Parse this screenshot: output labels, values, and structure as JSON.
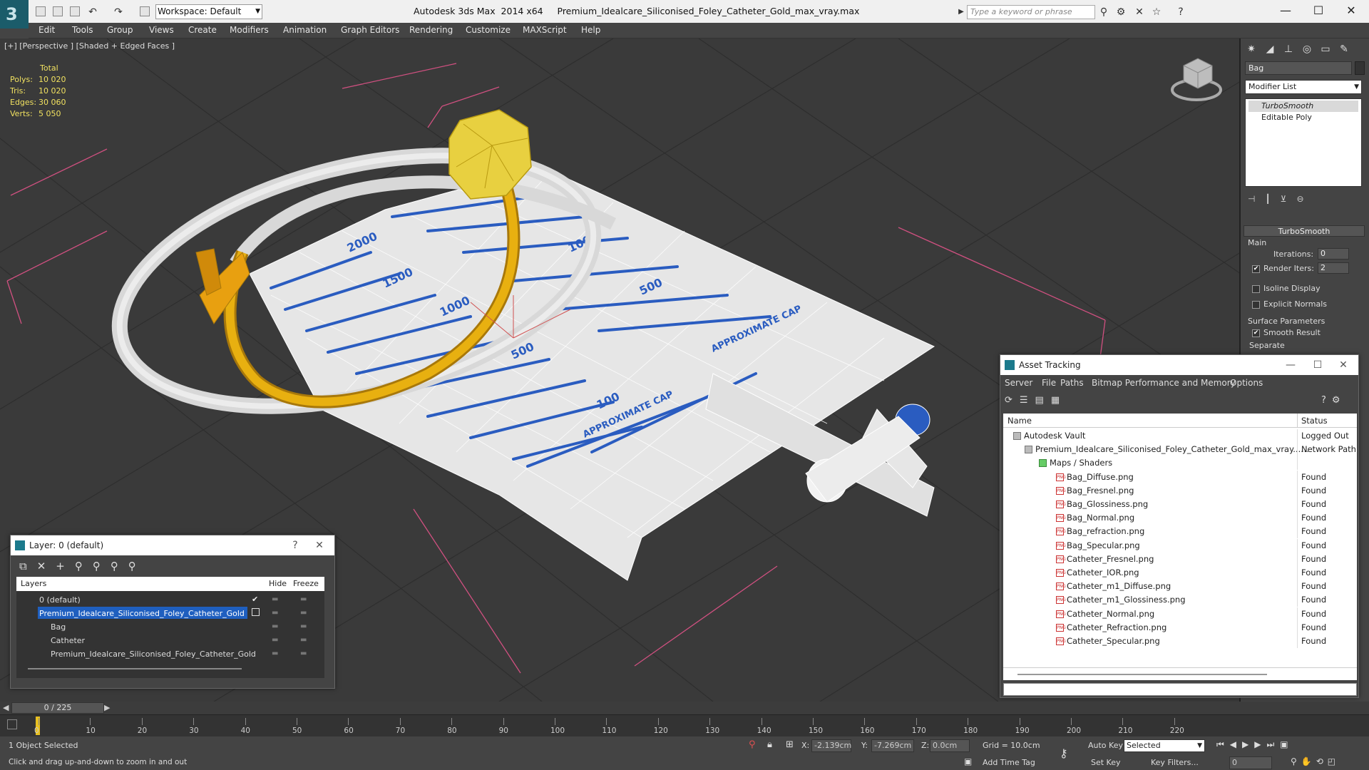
{
  "titlebar": {
    "app": "Autodesk 3ds Max  2014 x64",
    "file": "Premium_Idealcare_Siliconised_Foley_Catheter_Gold_max_vray.max",
    "workspace": "Workspace: Default",
    "search_placeholder": "Type a keyword or phrase"
  },
  "menu": [
    "Edit",
    "Tools",
    "Group",
    "Views",
    "Create",
    "Modifiers",
    "Animation",
    "Graph Editors",
    "Rendering",
    "Customize",
    "MAXScript",
    "Help"
  ],
  "viewport": {
    "label": "[+] [Perspective ] [Shaded + Edged Faces ]",
    "stats": {
      "total": "Total",
      "rows": [
        {
          "label": "Polys:",
          "value": "10 020"
        },
        {
          "label": "Tris:",
          "value": "10 020"
        },
        {
          "label": "Edges:",
          "value": "30 060"
        },
        {
          "label": "Verts:",
          "value": "5 050"
        }
      ]
    },
    "bag_labels": [
      "2000",
      "1500",
      "1000",
      "500",
      "100",
      "1000",
      "500",
      "APPROXIMATE CAP",
      "APPROXIMATE CAP"
    ]
  },
  "cmdpanel": {
    "object_name": "Bag",
    "modifier_list": "Modifier List",
    "stack": [
      "TurboSmooth",
      "Editable Poly"
    ],
    "rollout_title": "TurboSmooth",
    "main_label": "Main",
    "iterations_label": "Iterations:",
    "iterations_value": "0",
    "render_iters_label": "Render Iters:",
    "render_iters_value": "2",
    "isoline": "Isoline Display",
    "explicit": "Explicit Normals",
    "surface_params": "Surface Parameters",
    "smooth_result": "Smooth Result",
    "separate": "Separate"
  },
  "layerwin": {
    "title": "Layer: 0 (default)",
    "help": "?",
    "col_layers": "Layers",
    "col_hide": "Hide",
    "col_freeze": "Freeze",
    "rows": [
      {
        "name": "0 (default)",
        "indent": 0
      },
      {
        "name": "Premium_Idealcare_Siliconised_Foley_Catheter_Gold",
        "indent": 0
      },
      {
        "name": "Bag",
        "indent": 1
      },
      {
        "name": "Catheter",
        "indent": 1
      },
      {
        "name": "Premium_Idealcare_Siliconised_Foley_Catheter_Gold",
        "indent": 1
      }
    ]
  },
  "assetwin": {
    "title": "Asset Tracking",
    "menu": [
      "Server",
      "File",
      "Paths",
      "Bitmap Performance and Memory",
      "Options"
    ],
    "col_name": "Name",
    "col_status": "Status",
    "rows": [
      {
        "name": "Autodesk Vault",
        "status": "Logged Out ..."
      },
      {
        "name": "Premium_Idealcare_Siliconised_Foley_Catheter_Gold_max_vray....",
        "status": "Network Path"
      },
      {
        "name": "Maps / Shaders",
        "status": ""
      },
      {
        "name": "Bag_Diffuse.png",
        "status": "Found"
      },
      {
        "name": "Bag_Fresnel.png",
        "status": "Found"
      },
      {
        "name": "Bag_Glossiness.png",
        "status": "Found"
      },
      {
        "name": "Bag_Normal.png",
        "status": "Found"
      },
      {
        "name": "Bag_refraction.png",
        "status": "Found"
      },
      {
        "name": "Bag_Specular.png",
        "status": "Found"
      },
      {
        "name": "Catheter_Fresnel.png",
        "status": "Found"
      },
      {
        "name": "Catheter_IOR.png",
        "status": "Found"
      },
      {
        "name": "Catheter_m1_Diffuse.png",
        "status": "Found"
      },
      {
        "name": "Catheter_m1_Glossiness.png",
        "status": "Found"
      },
      {
        "name": "Catheter_Normal.png",
        "status": "Found"
      },
      {
        "name": "Catheter_Refraction.png",
        "status": "Found"
      },
      {
        "name": "Catheter_Specular.png",
        "status": "Found"
      }
    ]
  },
  "timeline": {
    "frame": "0 / 225",
    "ticks": [
      "0",
      "10",
      "20",
      "30",
      "40",
      "50",
      "60",
      "70",
      "80",
      "90",
      "100",
      "110",
      "120",
      "130",
      "140",
      "150",
      "160",
      "170",
      "180",
      "190",
      "200",
      "210",
      "220"
    ]
  },
  "status": {
    "selected": "1 Object Selected",
    "hint": "Click and drag up-and-down to zoom in and out",
    "x_label": "X:",
    "x_value": "-2.139cm",
    "y_label": "Y:",
    "y_value": "-7.269cm",
    "z_label": "Z:",
    "z_value": "0.0cm",
    "grid": "Grid = 10.0cm",
    "add_time_tag": "Add Time Tag",
    "auto_key": "Auto Key",
    "set_key": "Set Key",
    "selected_dd": "Selected",
    "key_filters": "Key Filters...",
    "frame_value": "0"
  },
  "colors": {
    "gold": "#e8b010",
    "bag_blue": "#2a5cc0",
    "viewport_bg": "#3a3a3a",
    "selection": "#1f5fbf"
  }
}
